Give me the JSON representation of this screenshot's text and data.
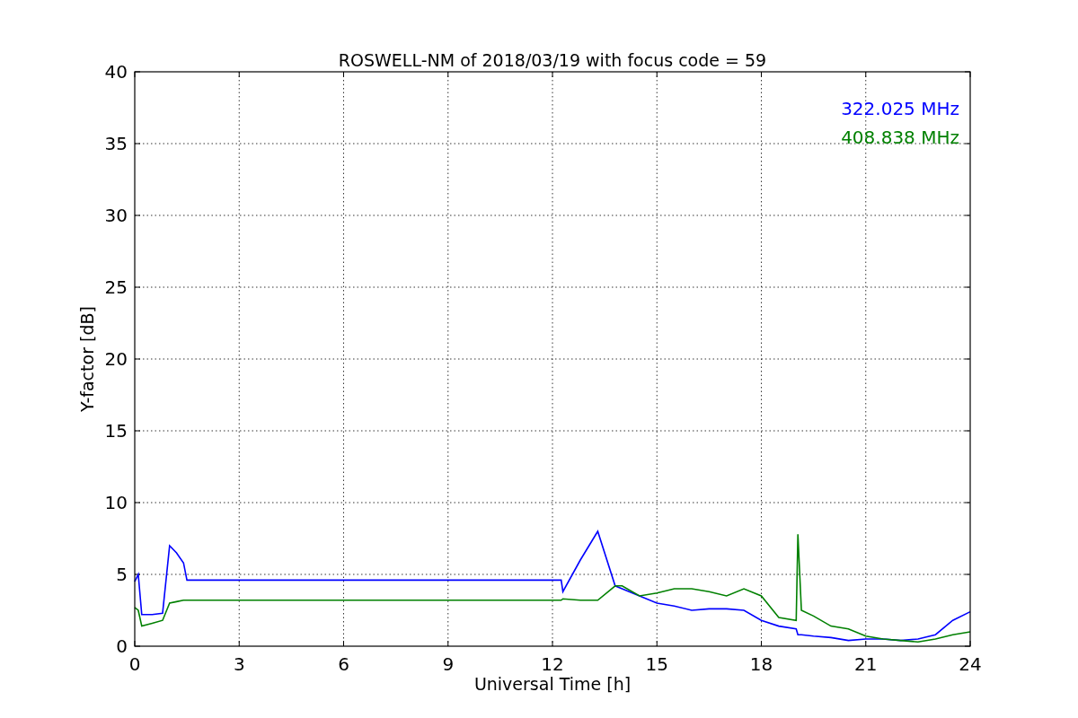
{
  "figure": {
    "chart_data": {
      "type": "line",
      "title": "ROSWELL-NM of 2018/03/19 with focus code = 59",
      "xlabel": "Universal Time [h]",
      "ylabel": "Y-factor [dB]",
      "x": [
        0,
        0.1,
        0.2,
        0.5,
        0.8,
        1,
        1.2,
        1.4,
        1.5,
        3,
        6,
        9,
        12.25,
        12.3,
        12.8,
        13.3,
        13.8,
        14,
        14.5,
        15,
        15.5,
        16,
        16.5,
        17,
        17.5,
        18,
        18.5,
        19,
        19.05,
        19.15,
        19.5,
        20,
        20.5,
        21,
        21.5,
        22,
        22.5,
        23,
        23.5,
        24
      ],
      "series": [
        {
          "name": "322.025 MHz",
          "color": "#0000ff",
          "values": [
            4.5,
            5,
            2.2,
            2.2,
            2.3,
            7,
            6.5,
            5.8,
            4.6,
            4.6,
            4.6,
            4.6,
            4.6,
            3.8,
            6,
            8,
            4.2,
            4,
            3.5,
            3,
            2.8,
            2.5,
            2.6,
            2.6,
            2.5,
            1.8,
            1.4,
            1.2,
            0.8,
            0.8,
            0.7,
            0.6,
            0.4,
            0.5,
            0.5,
            0.4,
            0.5,
            0.8,
            1.8,
            2.4
          ]
        },
        {
          "name": "408.838 MHz",
          "color": "#008000",
          "values": [
            2.7,
            2.5,
            1.4,
            1.6,
            1.8,
            3,
            3.1,
            3.2,
            3.2,
            3.2,
            3.2,
            3.2,
            3.2,
            3.3,
            3.2,
            3.2,
            4.2,
            4.2,
            3.5,
            3.7,
            4,
            4,
            3.8,
            3.5,
            4,
            3.5,
            2,
            1.8,
            7.8,
            2.5,
            2.1,
            1.4,
            1.2,
            0.7,
            0.5,
            0.4,
            0.3,
            0.5,
            0.8,
            1
          ]
        }
      ],
      "grid": true,
      "xlim": [
        0,
        24
      ],
      "ylim": [
        0,
        40
      ],
      "xticks": [
        0,
        3,
        6,
        9,
        12,
        15,
        18,
        21,
        24
      ],
      "yticks": [
        0,
        5,
        10,
        15,
        20,
        25,
        30,
        35,
        40
      ]
    }
  }
}
